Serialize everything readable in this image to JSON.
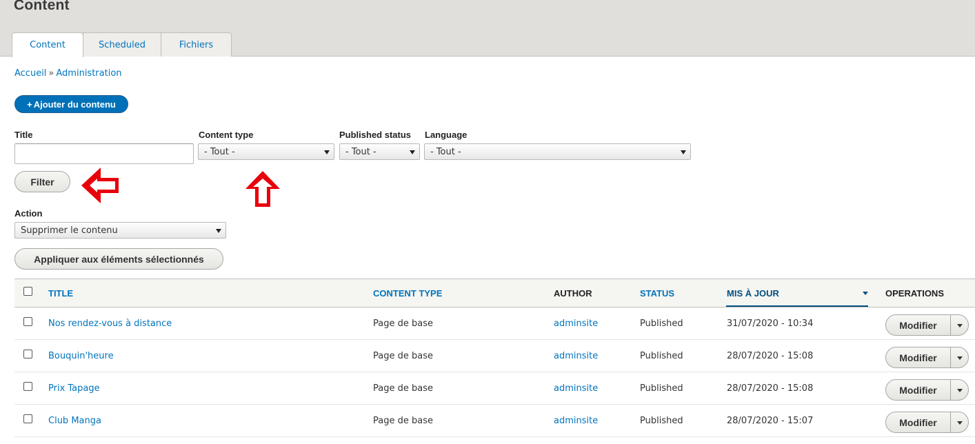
{
  "page": {
    "title": "Content"
  },
  "tabs": [
    {
      "label": "Content",
      "active": true
    },
    {
      "label": "Scheduled",
      "active": false
    },
    {
      "label": "Fichiers",
      "active": false
    }
  ],
  "breadcrumb": {
    "home": "Accueil",
    "separator": "»",
    "admin": "Administration"
  },
  "add_button": {
    "plus": "+",
    "label": "Ajouter du contenu"
  },
  "filters": {
    "title_label": "Title",
    "title_value": "",
    "content_type_label": "Content type",
    "content_type_value": "- Tout -",
    "published_label": "Published status",
    "published_value": "- Tout -",
    "language_label": "Language",
    "language_value": "- Tout -",
    "filter_button": "Filter"
  },
  "bulk": {
    "action_label": "Action",
    "action_value": "Supprimer le contenu",
    "apply_button": "Appliquer aux éléments sélectionnés"
  },
  "table": {
    "headers": {
      "title": "TITLE",
      "content_type": "CONTENT TYPE",
      "author": "AUTHOR",
      "status": "STATUS",
      "updated": "MIS À JOUR",
      "operations": "OPERATIONS"
    },
    "rows": [
      {
        "title": "Nos rendez-vous à distance",
        "type": "Page de base",
        "author": "adminsite",
        "status": "Published",
        "updated": "31/07/2020 - 10:34",
        "op": "Modifier"
      },
      {
        "title": "Bouquin'heure",
        "type": "Page de base",
        "author": "adminsite",
        "status": "Published",
        "updated": "28/07/2020 - 15:08",
        "op": "Modifier"
      },
      {
        "title": "Prix Tapage",
        "type": "Page de base",
        "author": "adminsite",
        "status": "Published",
        "updated": "28/07/2020 - 15:08",
        "op": "Modifier"
      },
      {
        "title": "Club Manga",
        "type": "Page de base",
        "author": "adminsite",
        "status": "Published",
        "updated": "28/07/2020 - 15:07",
        "op": "Modifier"
      }
    ]
  },
  "colors": {
    "link": "#0074bd",
    "primary_button": "#0071b8",
    "annotation_arrow": "#e8000b"
  },
  "annotations": [
    "left-arrow-icon",
    "up-arrow-icon"
  ]
}
